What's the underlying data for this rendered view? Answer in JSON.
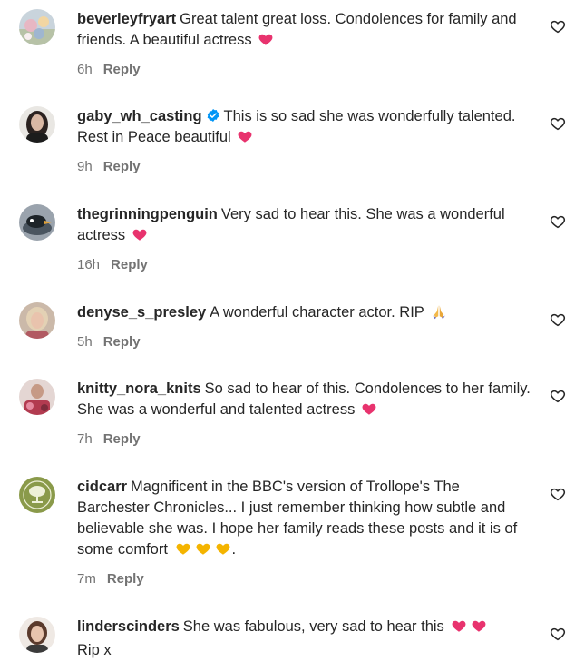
{
  "comments": [
    {
      "username": "beverleyfryart",
      "text": "Great talent great loss. Condolences for family and friends. A beautiful actress",
      "emoji": "heart",
      "time": "6h",
      "reply_label": "Reply",
      "avatar_icon": "avatar-flowers"
    },
    {
      "username": "gaby_wh_casting",
      "verified": true,
      "text": "This is so sad she was wonderfully talented. Rest in Peace beautiful",
      "emoji": "heart",
      "time": "9h",
      "reply_label": "Reply",
      "avatar_icon": "avatar-portrait-dark-hair"
    },
    {
      "username": "thegrinningpenguin",
      "text": "Very sad to hear this. She was a wonderful actress",
      "emoji": "heart",
      "time": "16h",
      "reply_label": "Reply",
      "avatar_icon": "avatar-penguin"
    },
    {
      "username": "denyse_s_presley",
      "text": "A wonderful character actor. RIP",
      "emoji": "praying-hands",
      "time": "5h",
      "reply_label": "Reply",
      "avatar_icon": "avatar-portrait-blonde"
    },
    {
      "username": "knitty_nora_knits",
      "text": "So sad to hear of this. Condolences to her family. She was a wonderful and talented actress",
      "emoji": "heart",
      "time": "7h",
      "reply_label": "Reply",
      "avatar_icon": "avatar-knitting"
    },
    {
      "username": "cidcarr",
      "text": "Magnificent in the BBC's version of Trollope's The Barchester Chronicles... I just remember thinking how subtle and believable she was. I hope her family reads these posts and it is of some comfort",
      "emoji": "yellow-hearts",
      "emoji_suffix": ".",
      "time": "7m",
      "reply_label": "Reply",
      "avatar_icon": "avatar-tree-logo"
    },
    {
      "username": "linderscinders",
      "text": "She was fabulous, very sad to hear this",
      "emoji": "two-hearts",
      "text_after": "Rip x",
      "avatar_icon": "avatar-portrait-brunette"
    }
  ],
  "colors": {
    "heart_pink": "#e8336e",
    "yellow_heart": "#f4b400",
    "verified_blue": "#0095f6",
    "muted": "#737373",
    "text": "#262626"
  }
}
